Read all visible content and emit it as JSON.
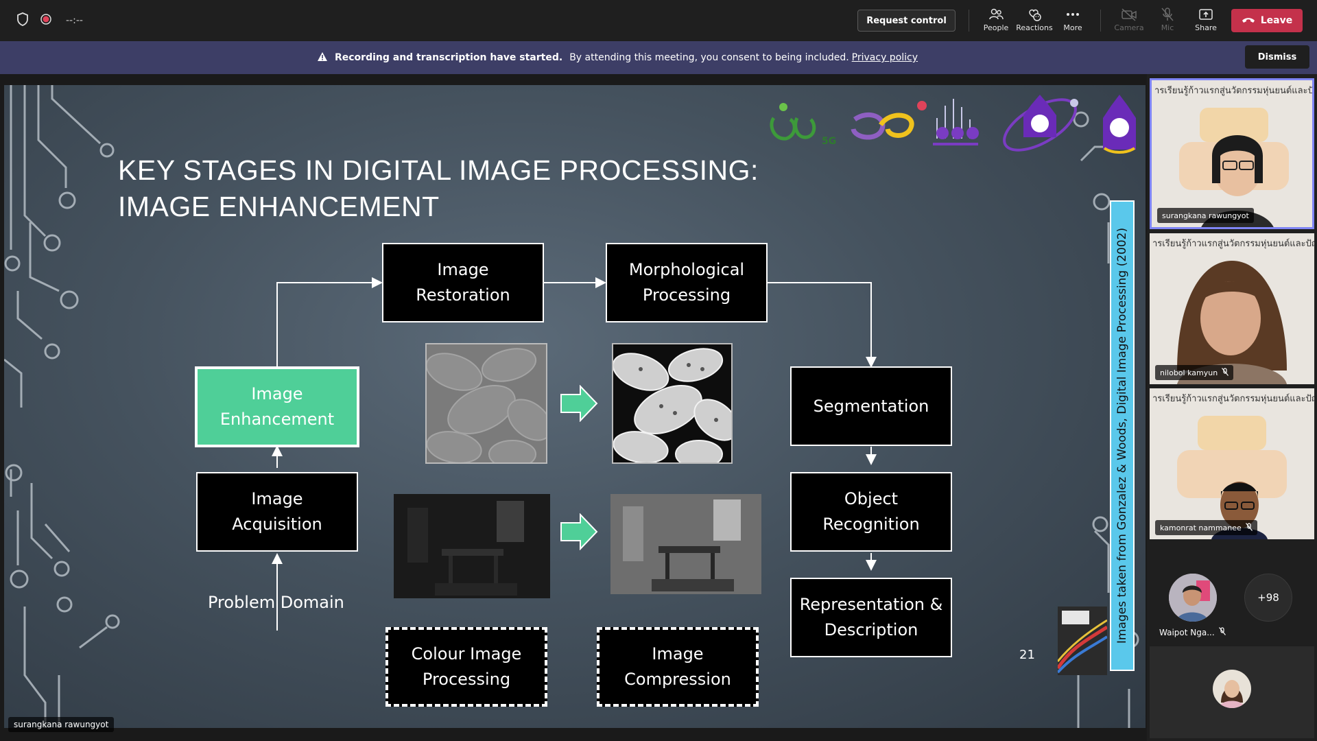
{
  "topbar": {
    "timer": "--:--",
    "request_control": "Request control",
    "items": [
      {
        "label": "People",
        "icon": "people-icon"
      },
      {
        "label": "Reactions",
        "icon": "reactions-icon"
      },
      {
        "label": "More",
        "icon": "more-icon"
      },
      {
        "label": "Camera",
        "icon": "camera-off-icon"
      },
      {
        "label": "Mic",
        "icon": "mic-off-icon"
      },
      {
        "label": "Share",
        "icon": "share-icon"
      }
    ],
    "leave": "Leave",
    "leave_color": "#c4314b"
  },
  "banner": {
    "bold": "Recording and transcription have started.",
    "text": "By attending this meeting, you consent to being included.",
    "link": "Privacy policy",
    "dismiss": "Dismiss",
    "color": "#3d3e66"
  },
  "slide": {
    "title_line1": "KEY STAGES IN DIGITAL IMAGE PROCESSING:",
    "title_line2": "IMAGE ENHANCEMENT",
    "boxes": {
      "restoration": "Image\nRestoration",
      "morphological": "Morphological\nProcessing",
      "enhancement": "Image\nEnhancement",
      "acquisition": "Image\nAcquisition",
      "segmentation": "Segmentation",
      "recognition": "Object\nRecognition",
      "representation": "Representation &\nDescription",
      "colour": "Colour Image\nProcessing",
      "compression": "Image\nCompression"
    },
    "problem_domain": "Problem Domain",
    "page_number": "21",
    "credit": "Images taken from Gonzalez & Woods, Digital Image Processing (2002)",
    "highlight_color": "#4fcf98",
    "presenter": "surangkana rawungyot"
  },
  "participants": {
    "tiles": [
      {
        "name": "surangkana rawungyot",
        "header": "ารเรียนรู้ก้าวแรกสู่นวัตกรรมหุ่นยนต์และปัญญ",
        "muted": false
      },
      {
        "name": "nilobol kamyun",
        "header": "ารเรียนรู้ก้าวแรกสู่นวัตกรรมหุ่นยนต์และปัญญ",
        "muted": true
      },
      {
        "name": "kamonrat nammanee",
        "header": "ารเรียนรู้ก้าวแรกสู่นวัตกรรมหุ่นยนต์และปัญญ",
        "muted": true
      }
    ],
    "avatar_name": "Waipot Nga...",
    "more_count": "+98"
  }
}
